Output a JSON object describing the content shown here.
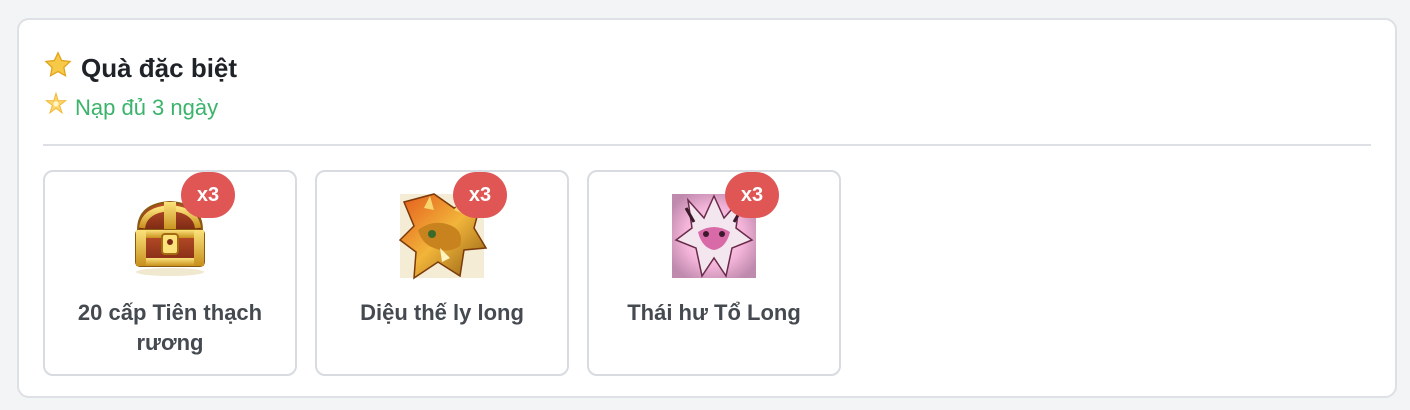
{
  "section": {
    "title": "Quà đặc biệt",
    "title_icon": "star-icon",
    "subtitle": "Nạp đủ 3 ngày",
    "subtitle_icon": "sparkle-star-icon",
    "subtitle_color": "#3bb36b"
  },
  "gifts": [
    {
      "name": "20 cấp Tiên thạch rương",
      "badge": "x3",
      "icon": "treasure-chest-icon"
    },
    {
      "name": "Diệu thế ly long",
      "badge": "x3",
      "icon": "golden-dragon-icon"
    },
    {
      "name": "Thái hư Tổ Long",
      "badge": "x3",
      "icon": "pink-dragon-icon"
    }
  ],
  "colors": {
    "badge": "#e05655",
    "border": "#d8dbe0",
    "title": "#1f2328"
  }
}
